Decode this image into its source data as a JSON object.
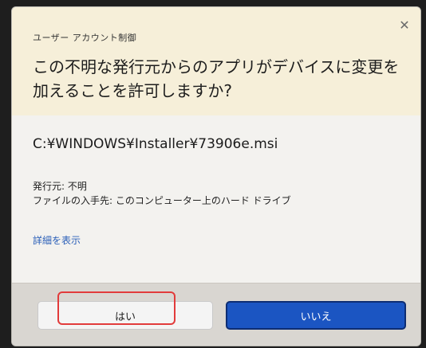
{
  "dialog": {
    "title": "ユーザー アカウント制御",
    "close_icon": "close-icon",
    "question": "この不明な発行元からのアプリがデバイスに変更を加えることを許可しますか?",
    "file_path": "C:¥WINDOWS¥Installer¥73906e.msi",
    "publisher_line": "発行元: 不明",
    "origin_line": "ファイルの入手先: このコンピューター上のハード ドライブ",
    "details_link": "詳細を表示",
    "yes_label": "はい",
    "no_label": "いいえ"
  },
  "colors": {
    "header_bg": "#f6efd9",
    "body_bg": "#f3f2ef",
    "footer_bg": "#d9d6d1",
    "primary_button": "#1b55c2",
    "link": "#2a5fb8",
    "highlight": "#e23b3b"
  }
}
